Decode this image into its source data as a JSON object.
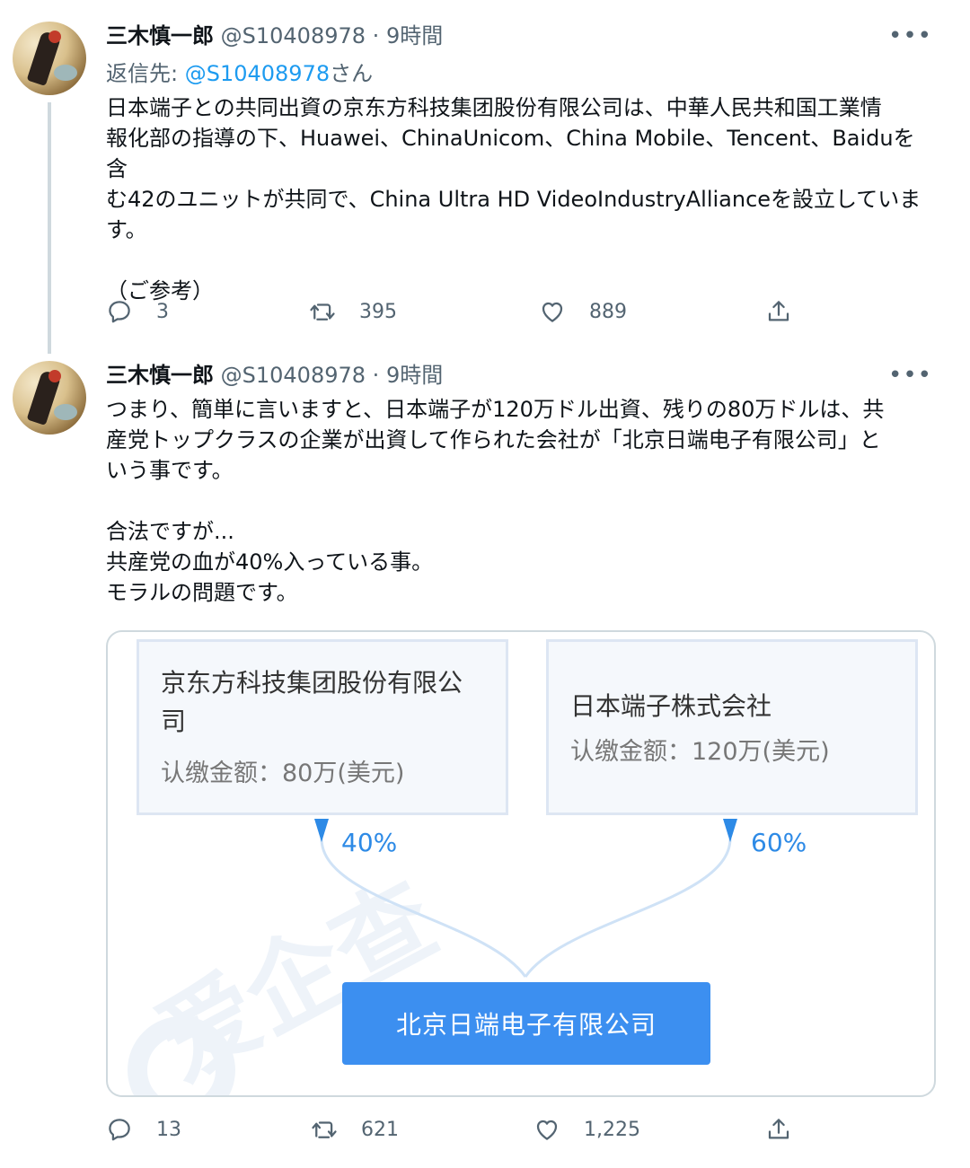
{
  "tweets": [
    {
      "name": "三木慎一郎",
      "handle": "@S10408978",
      "dot": "·",
      "time": "9時間",
      "reply_prefix": "返信先: ",
      "reply_mention": "@S10408978",
      "reply_suffix": "さん",
      "body": [
        "日本端子との共同出資の京东方科技集团股份有限公司は、中華人民共和国工業情",
        "報化部の指導の下、Huawei、ChinaUnicom、China Mobile、Tencent、Baiduを含",
        "む42のユニットが共同で、China Ultra HD VideoIndustryAllianceを設立していま",
        "す。",
        "",
        "（ご参考）"
      ],
      "replies": "3",
      "retweets": "395",
      "likes": "889"
    },
    {
      "name": "三木慎一郎",
      "handle": "@S10408978",
      "dot": "·",
      "time": "9時間",
      "body": [
        "つまり、簡単に言いますと、日本端子が120万ドル出資、残りの80万ドルは、共",
        "産党トップクラスの企業が出資して作られた会社が「北京日端电子有限公司」と",
        "いう事です。",
        "",
        "合法ですが...",
        "共産党の血が40%入っている事。",
        "モラルの問題です。"
      ],
      "replies": "13",
      "retweets": "621",
      "likes": "1,225"
    }
  ],
  "card": {
    "left_company_line1": "京东方科技集团股份有限公",
    "left_company_line2": "司",
    "left_amount": "认缴金额：80万(美元)",
    "right_company": "日本端子株式会社",
    "right_amount": "认缴金额：120万(美元)",
    "left_pct": "40%",
    "right_pct": "60%",
    "result_company": "北京日端电子有限公司",
    "watermark": "爱企查"
  },
  "more_label": "•••",
  "icons": [
    "reply-icon",
    "retweet-icon",
    "like-icon",
    "share-icon",
    "more-icon"
  ],
  "colors": {
    "link": "#1d9bf0",
    "muted": "#536471",
    "accent_blue": "#3c8ff0"
  }
}
